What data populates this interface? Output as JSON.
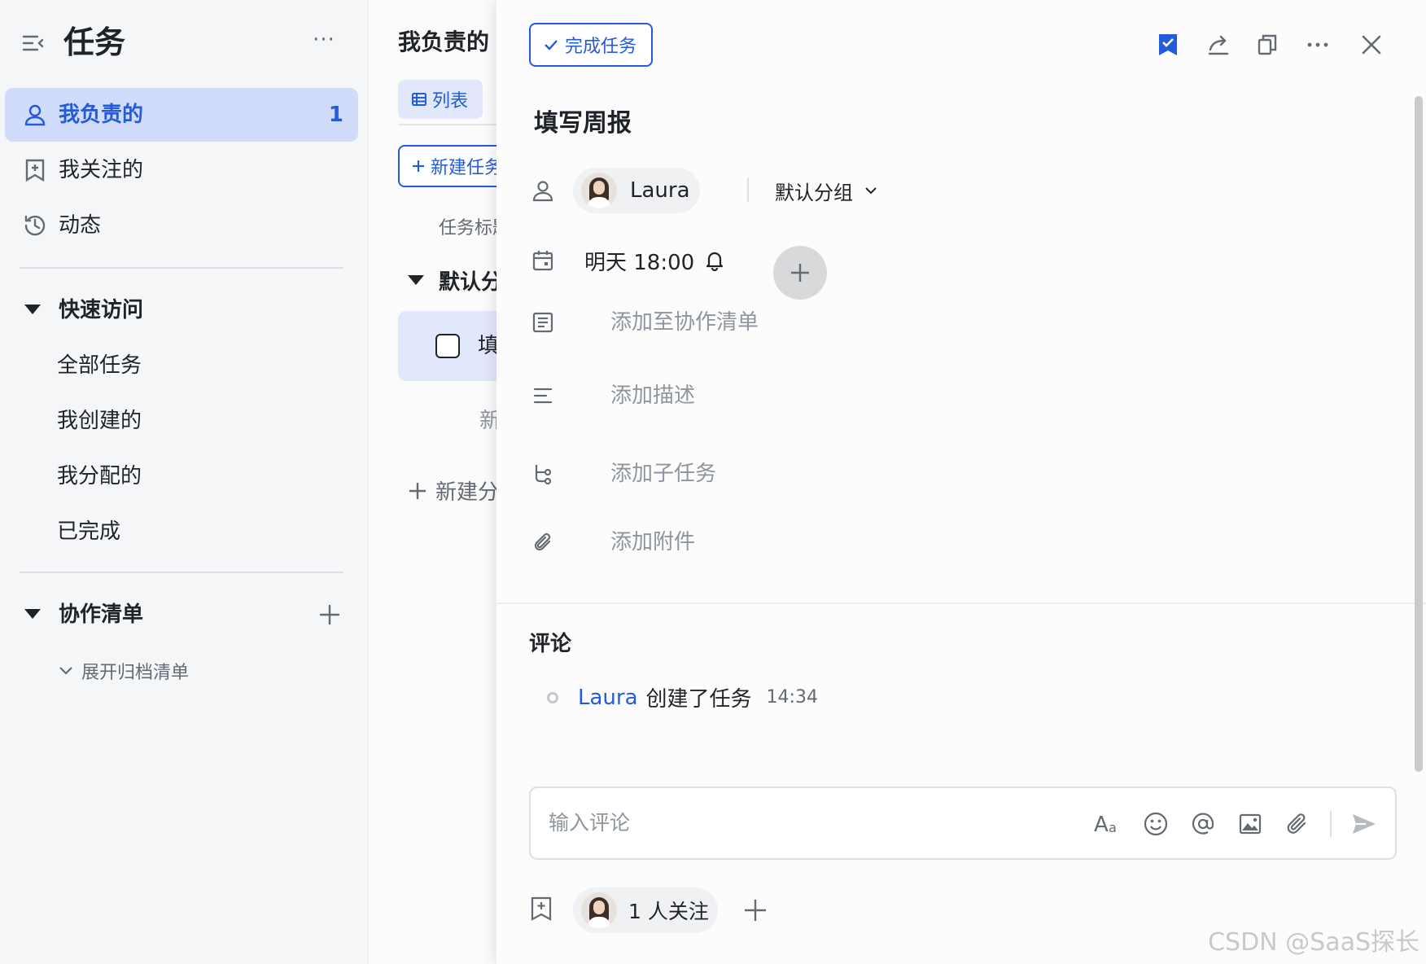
{
  "sidebar": {
    "title": "任务",
    "more": "···",
    "nav": [
      {
        "label": "我负责的",
        "count": "1",
        "icon": "person-icon"
      },
      {
        "label": "我关注的",
        "icon": "bookmark-add-icon"
      },
      {
        "label": "动态",
        "icon": "history-icon"
      }
    ],
    "quick_access": {
      "title": "快速访问",
      "items": [
        "全部任务",
        "我创建的",
        "我分配的",
        "已完成"
      ]
    },
    "collab_lists": {
      "title": "协作清单",
      "expand_archived": "展开归档清单"
    }
  },
  "middle": {
    "title": "我负责的",
    "view_tab": "列表",
    "new_task": "新建任务",
    "column_header": "任务标题",
    "group_header": "默认分组",
    "task_title": "填写周报",
    "new_subtask": "新建任务",
    "new_group": "新建分组"
  },
  "detail": {
    "complete_button": "完成任务",
    "title": "填写周报",
    "assignee": "Laura",
    "group": "默认分组",
    "due": "明天 18:00",
    "add_to_list": "添加至协作清单",
    "add_description": "添加描述",
    "add_subtask": "添加子任务",
    "add_attachment": "添加附件",
    "comments_title": "评论",
    "activity": {
      "user": "Laura",
      "action": "创建了任务",
      "time": "14:34"
    },
    "comment_placeholder": "输入评论",
    "followers": "1 人关注"
  },
  "watermark": "CSDN @SaaS探长",
  "colors": {
    "accent": "#245bdb",
    "active_bg": "#d1dcfb",
    "text": "#1f2329",
    "muted": "#8f959e"
  }
}
